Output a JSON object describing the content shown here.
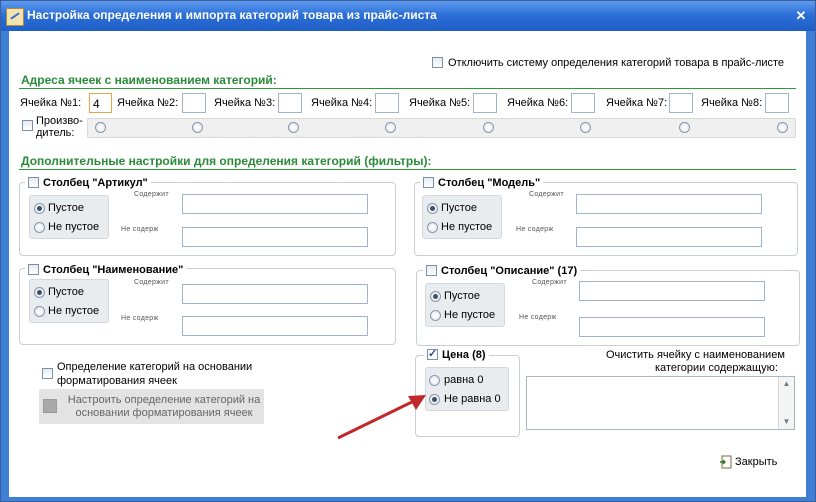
{
  "window": {
    "title": "Настройка определения и импорта категорий товара из прайс-листа",
    "close_glyph": "✕"
  },
  "top_option": {
    "label": "Отключить систему определения категорий товара в прайс-листе",
    "checked": false
  },
  "addresses": {
    "title": "Адреса ячеек с наименованием категорий:",
    "cells": [
      {
        "label": "Ячейка №1:",
        "value": "4"
      },
      {
        "label": "Ячейка №2:",
        "value": ""
      },
      {
        "label": "Ячейка №3:",
        "value": ""
      },
      {
        "label": "Ячейка №4:",
        "value": ""
      },
      {
        "label": "Ячейка №5:",
        "value": ""
      },
      {
        "label": "Ячейка №6:",
        "value": ""
      },
      {
        "label": "Ячейка №7:",
        "value": ""
      },
      {
        "label": "Ячейка №8:",
        "value": ""
      }
    ],
    "manufacturer": {
      "label_line1": "Произво-",
      "label_line2": "дитель:",
      "checked": false
    }
  },
  "filters": {
    "title": "Дополнительные настройки для определения категорий (фильтры):",
    "contains_label": "Содержит",
    "not_contains_label": "Не содерж",
    "columns": [
      {
        "title": "Столбец \"Артикул\"",
        "checked": false,
        "opt_empty": "Пустое",
        "opt_nonempty": "Не пустое",
        "selected": "empty"
      },
      {
        "title": "Столбец \"Модель\"",
        "checked": false,
        "opt_empty": "Пустое",
        "opt_nonempty": "Не пустое",
        "selected": "empty"
      },
      {
        "title": "Столбец \"Наименование\"",
        "checked": false,
        "opt_empty": "Пустое",
        "opt_nonempty": "Не пустое",
        "selected": "empty"
      },
      {
        "title": "Столбец \"Описание\" (17)",
        "checked": false,
        "opt_empty": "Пустое",
        "opt_nonempty": "Не пустое",
        "selected": "empty"
      }
    ]
  },
  "format_option": {
    "line1": "Определение категорий на основании",
    "line2": "форматирования ячеек",
    "checked": false
  },
  "format_button": {
    "line1": "Настроить определение категорий на",
    "line2": "основании форматирования ячеек"
  },
  "price": {
    "title": "Цена (8)",
    "checked": true,
    "opt_zero": "равна 0",
    "opt_nonzero": "Не равна 0",
    "selected": "nonzero"
  },
  "clear_cell": {
    "line1": "Очистить ячейку с наименованием",
    "line2": "категории содержащую:",
    "value": ""
  },
  "close_button": {
    "label": "Закрыть"
  },
  "colors": {
    "group_title": "#2a8a3a",
    "titlebar": "#2c6fd6",
    "annotation_arrow": "#c0282a"
  }
}
